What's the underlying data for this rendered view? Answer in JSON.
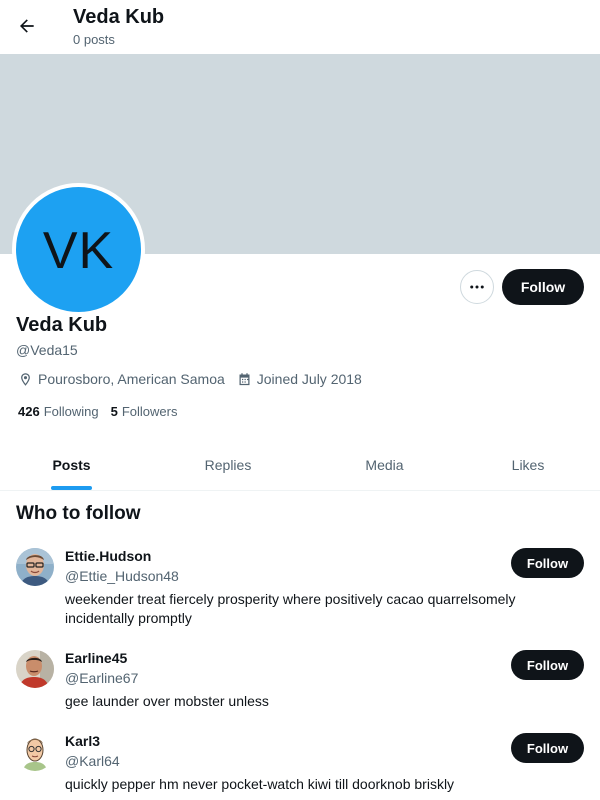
{
  "header": {
    "name": "Veda Kub",
    "post_count": "0 posts"
  },
  "profile": {
    "avatar_initials": "VK",
    "avatar_color": "#1da1f2",
    "banner_color": "#cfd9de",
    "name": "Veda Kub",
    "handle": "@Veda15",
    "location": "Pourosboro, American Samoa",
    "joined": "Joined July 2018",
    "following_count": "426",
    "following_label": "Following",
    "followers_count": "5",
    "followers_label": "Followers",
    "follow_label": "Follow"
  },
  "tabs": [
    {
      "label": "Posts",
      "active": true
    },
    {
      "label": "Replies",
      "active": false
    },
    {
      "label": "Media",
      "active": false
    },
    {
      "label": "Likes",
      "active": false
    }
  ],
  "who_to_follow": {
    "title": "Who to follow",
    "items": [
      {
        "name": "Ettie.Hudson",
        "handle": "@Ettie_Hudson48",
        "bio": "weekender treat fiercely prosperity where positively cacao quarrelsomely incidentally promptly",
        "follow_label": "Follow",
        "avatar": "photo-man-glasses"
      },
      {
        "name": "Earline45",
        "handle": "@Earline67",
        "bio": "gee launder over mobster unless",
        "follow_label": "Follow",
        "avatar": "photo-man-red-shirt"
      },
      {
        "name": "Karl3",
        "handle": "@Karl64",
        "bio": "quickly pepper hm never pocket-watch kiwi till doorknob briskly",
        "follow_label": "Follow",
        "avatar": "cartoon-man-glasses"
      }
    ]
  },
  "colors": {
    "accent": "#1d9bf0",
    "button_dark": "#0f1419",
    "secondary_text": "#536471"
  }
}
